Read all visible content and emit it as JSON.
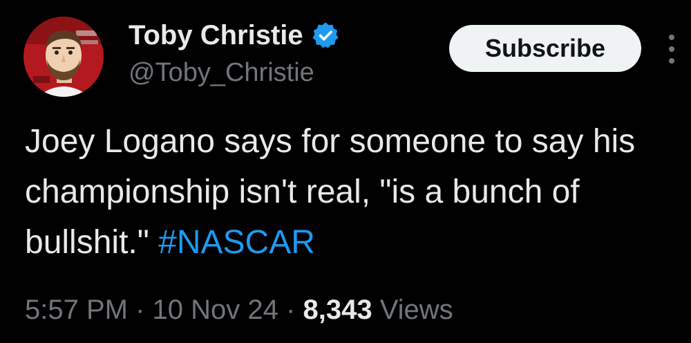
{
  "author": {
    "display_name": "Toby Christie",
    "handle": "@Toby_Christie",
    "verified_icon": "verified-check-icon",
    "avatar_icon": "avatar-illustration"
  },
  "actions": {
    "subscribe_label": "Subscribe",
    "more_icon": "more-vertical-icon"
  },
  "tweet": {
    "text": "Joey Logano says for someone to say his championship isn't real, \"is a bunch of bullshit.\"",
    "hashtag": "#NASCAR"
  },
  "meta": {
    "time": "5:57 PM",
    "separator_1": "·",
    "date": "10 Nov 24",
    "separator_2": "·",
    "views_count": "8,343",
    "views_label": "Views"
  },
  "colors": {
    "background": "#000000",
    "primary_text": "#e7e9ea",
    "secondary_text": "#71767b",
    "accent": "#1d9bf0",
    "button_bg": "#eff3f4"
  }
}
